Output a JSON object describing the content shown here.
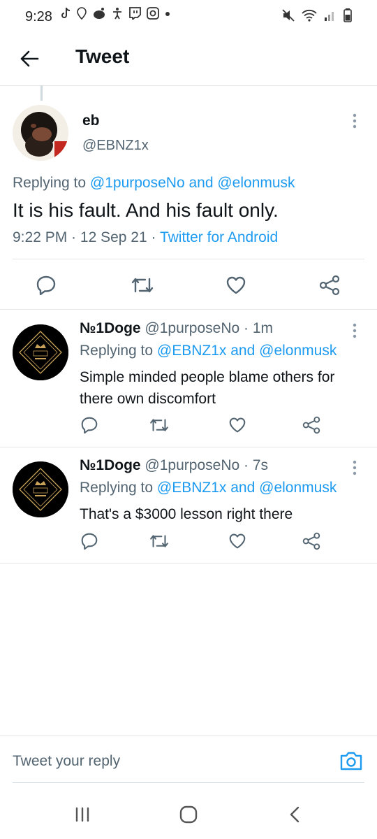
{
  "status_bar": {
    "time": "9:28",
    "left_icons": [
      "tiktok-icon",
      "location-icon",
      "reddit-icon",
      "accessibility-icon",
      "twitch-icon",
      "instagram-icon",
      "dot-icon"
    ],
    "right_icons": [
      "mute-icon",
      "wifi-icon",
      "signal-icon",
      "battery-icon"
    ]
  },
  "header": {
    "title": "Tweet",
    "back_icon": "arrow-left-icon"
  },
  "main_tweet": {
    "name": "eb",
    "handle": "@EBNZ1x",
    "replying_prefix": "Replying to ",
    "replying_user1": "@1purposeNo",
    "replying_and": " and ",
    "replying_user2": "@elonmusk",
    "text": "It is his fault. And his fault only.",
    "time": "9:22 PM",
    "sep1": " · ",
    "date": "12 Sep 21",
    "sep2": " · ",
    "source": "Twitter for Android",
    "actions": [
      "reply-icon",
      "retweet-icon",
      "like-icon",
      "share-icon"
    ]
  },
  "replies": [
    {
      "name": "№1Doge",
      "handle_time": " @1purposeNo · 1m",
      "replying_prefix": "Replying to ",
      "replying_user1": "@EBNZ1x",
      "replying_and": " and ",
      "replying_user2": "@elonmusk",
      "text": "Simple minded people blame others for there own discomfort"
    },
    {
      "name": "№1Doge",
      "handle_time": " @1purposeNo · 7s",
      "replying_prefix": "Replying to ",
      "replying_user1": "@EBNZ1x",
      "replying_and": " and ",
      "replying_user2": "@elonmusk",
      "text": "That's a $3000 lesson right there"
    }
  ],
  "compose": {
    "placeholder": "Tweet your reply",
    "camera_icon": "camera-icon"
  },
  "nav_bar": {
    "icons": [
      "recent-apps-icon",
      "home-icon",
      "back-icon"
    ]
  },
  "colors": {
    "link": "#1d9bf0",
    "text": "#0f1419",
    "secondary": "#536471",
    "divider": "#e6e6e6"
  }
}
